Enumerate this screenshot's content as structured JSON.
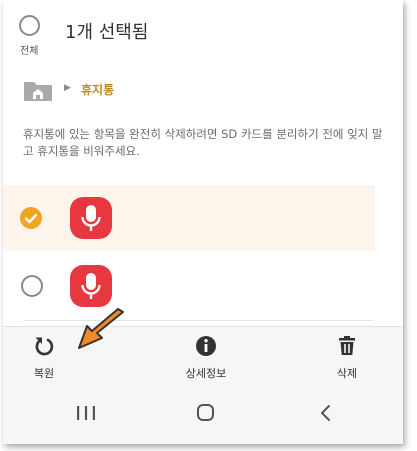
{
  "header": {
    "select_all_label": "전체",
    "title": "1개 선택됨"
  },
  "path": {
    "current_folder": "휴지통"
  },
  "notice": "휴지통에 있는 항목을 완전히 삭제하려면 SD 카드를 분리하기 전에 잊지 말고 휴지통을 비워주세요.",
  "items": [
    {
      "selected": true,
      "icon": "voice-recorder-icon"
    },
    {
      "selected": false,
      "icon": "voice-recorder-icon"
    }
  ],
  "toolbar": {
    "restore_label": "복원",
    "details_label": "상세정보",
    "delete_label": "삭제"
  },
  "colors": {
    "accent": "#f0a424",
    "folder_text": "#c08a1f",
    "mic_tile": "#e8383f",
    "selected_row": "#fdf5ec",
    "callout": "#f08a24"
  }
}
